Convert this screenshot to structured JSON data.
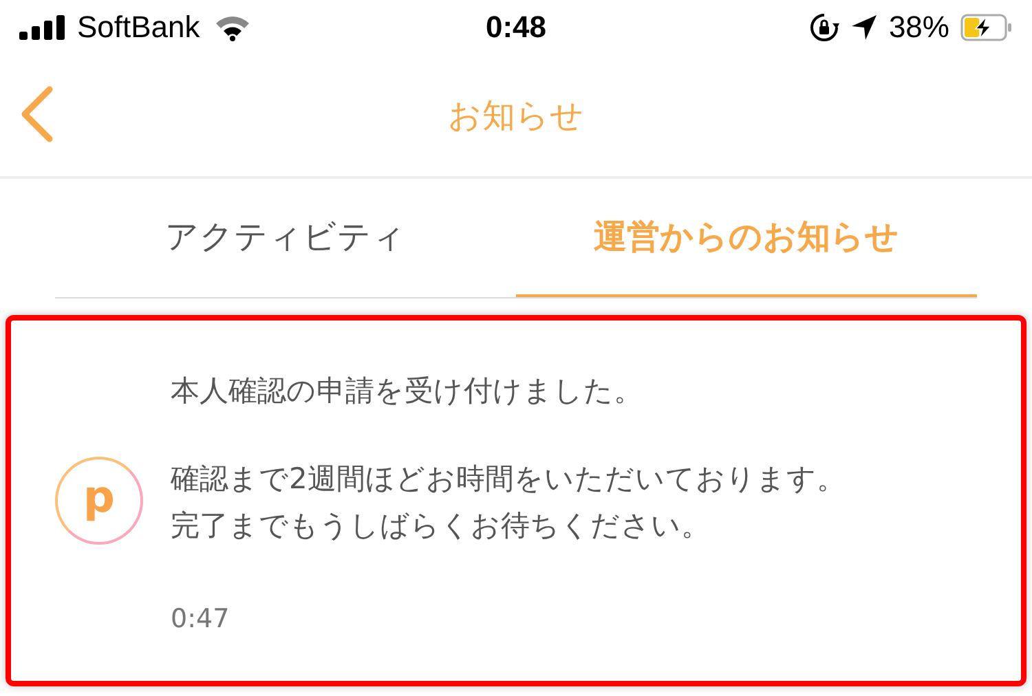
{
  "status_bar": {
    "carrier": "SoftBank",
    "time": "0:48",
    "battery_percent": "38%",
    "charging": true
  },
  "nav": {
    "title": "お知らせ"
  },
  "tabs": [
    {
      "label": "アクティビティ",
      "selected": false
    },
    {
      "label": "運営からのお知らせ",
      "selected": true
    }
  ],
  "notices": [
    {
      "logo_letter": "p",
      "paragraphs": [
        [
          "本人確認の申請を受け付けました。"
        ],
        [
          "確認まで2週間ほどお時間をいただいております。",
          "完了までもうしばらくお待ちください。"
        ]
      ],
      "time": "0:47",
      "highlighted": true
    }
  ]
}
